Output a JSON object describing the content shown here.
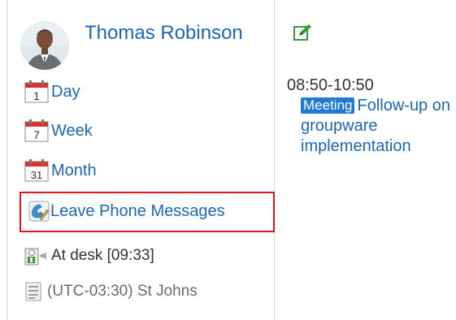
{
  "user": {
    "name": "Thomas Robinson"
  },
  "menu": {
    "day": {
      "label": "Day",
      "icon_number": "1"
    },
    "week": {
      "label": "Week",
      "icon_number": "7"
    },
    "month": {
      "label": "Month",
      "icon_number": "31"
    },
    "phone_messages": {
      "label": "Leave Phone Messages"
    }
  },
  "presence": {
    "status": "At desk [09:33]"
  },
  "timezone": {
    "label": "(UTC-03:30) St Johns"
  },
  "schedule": {
    "time": "08:50-10:50",
    "badge": "Meeting",
    "title": "Follow-up on groupware implementation"
  },
  "colors": {
    "link": "#1a66b8",
    "badge": "#1e7ad6",
    "highlight": "#e3141f",
    "calendar_red": "#d9342b",
    "edit_green": "#3a9a3a"
  }
}
